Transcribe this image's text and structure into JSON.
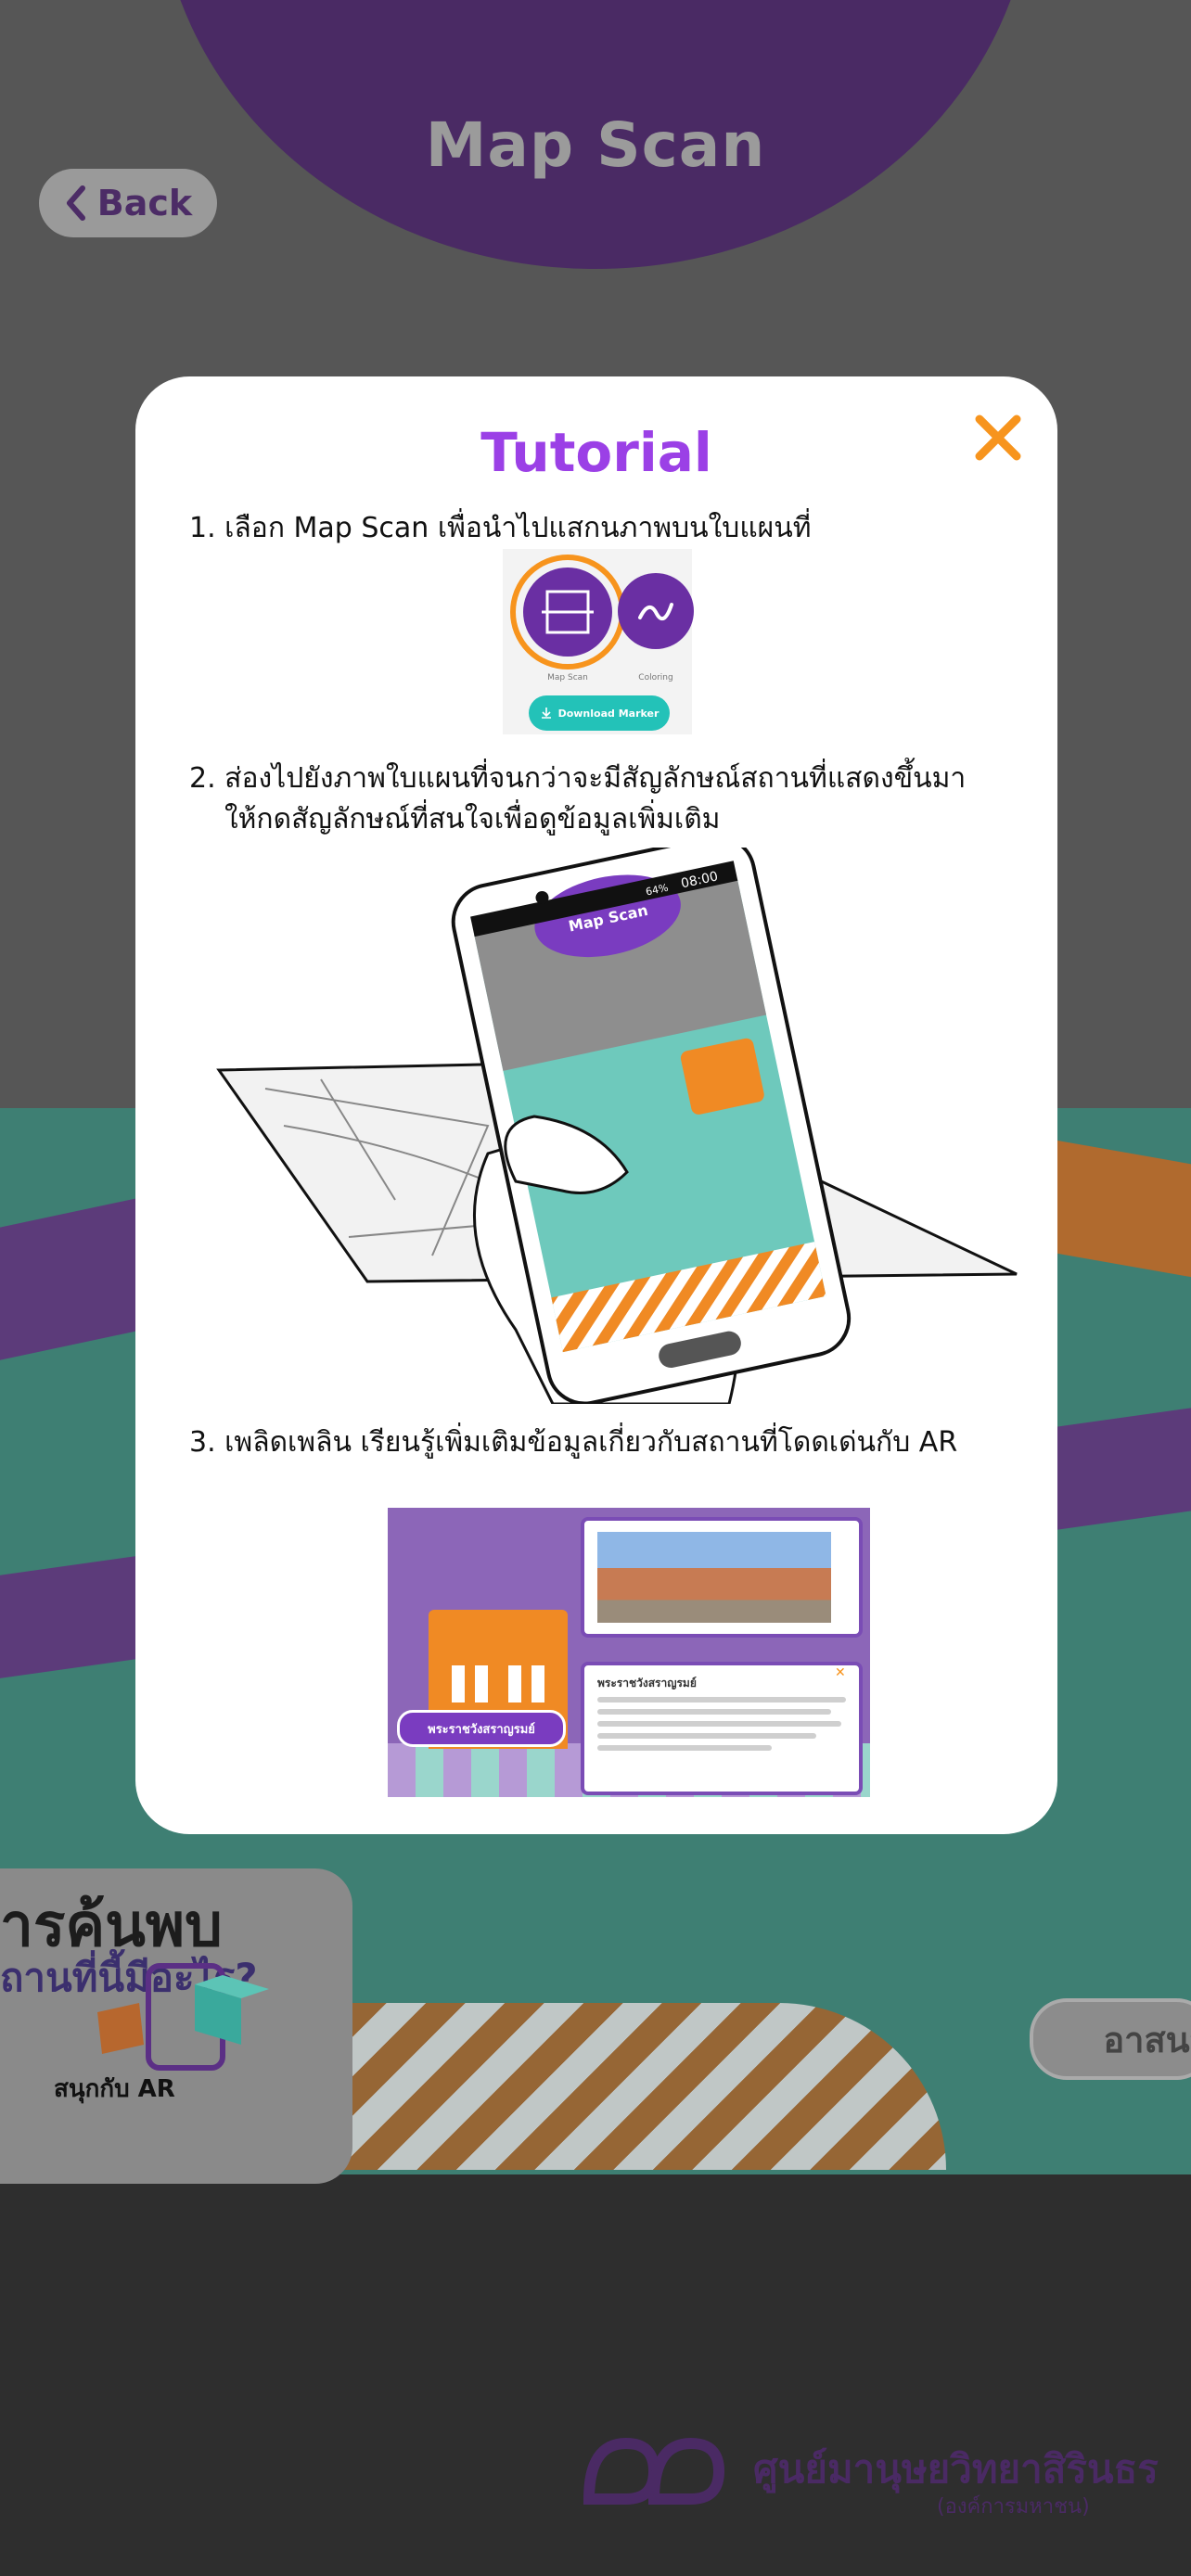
{
  "header": {
    "title": "Map Scan",
    "back_label": "Back"
  },
  "modal": {
    "title": "Tutorial",
    "steps": [
      {
        "line1": "1. เลือก Map Scan เพื่อนำไปแสกนภาพบนใบแผนที่"
      },
      {
        "line1": "2. ส่องไปยังภาพใบแผนที่จนกว่าจะมีสัญลักษณ์สถานที่แสดงขึ้นมา",
        "line2": "ให้กดสัญลักษณ์ที่สนใจเพื่อดูข้อมูลเพิ่มเติม"
      },
      {
        "line1": "3. เพลิดเพลิน เรียนรู้เพิ่มเติมข้อมูลเกี่ยวกับสถานที่โดดเด่นกับ AR"
      }
    ],
    "step1_art": {
      "map_scan_label": "Map Scan",
      "coloring_label": "Coloring",
      "download_label": "Download Marker"
    },
    "step2_art": {
      "phone_title": "Map Scan",
      "status_time": "08:00",
      "status_battery": "64%"
    },
    "step3_art": {
      "info_title": "พระราชวังสราญรมย์",
      "badge_label": "พระราชวังสราญรมย์"
    }
  },
  "background": {
    "panel_line1": "ารค้นพบ",
    "panel_line2": "ถานที่นี้มีอะไร?",
    "panel_line3": "สนุกกับ AR",
    "right_pill": "อาสนว",
    "footer_name": "ศูนย์มานุษยวิทยาสิรินธร",
    "footer_sub": "(องค์การมหาชน)"
  },
  "colors": {
    "accent_purple": "#9b40e6",
    "close_orange": "#f7941d",
    "teal": "#23c2b8"
  }
}
